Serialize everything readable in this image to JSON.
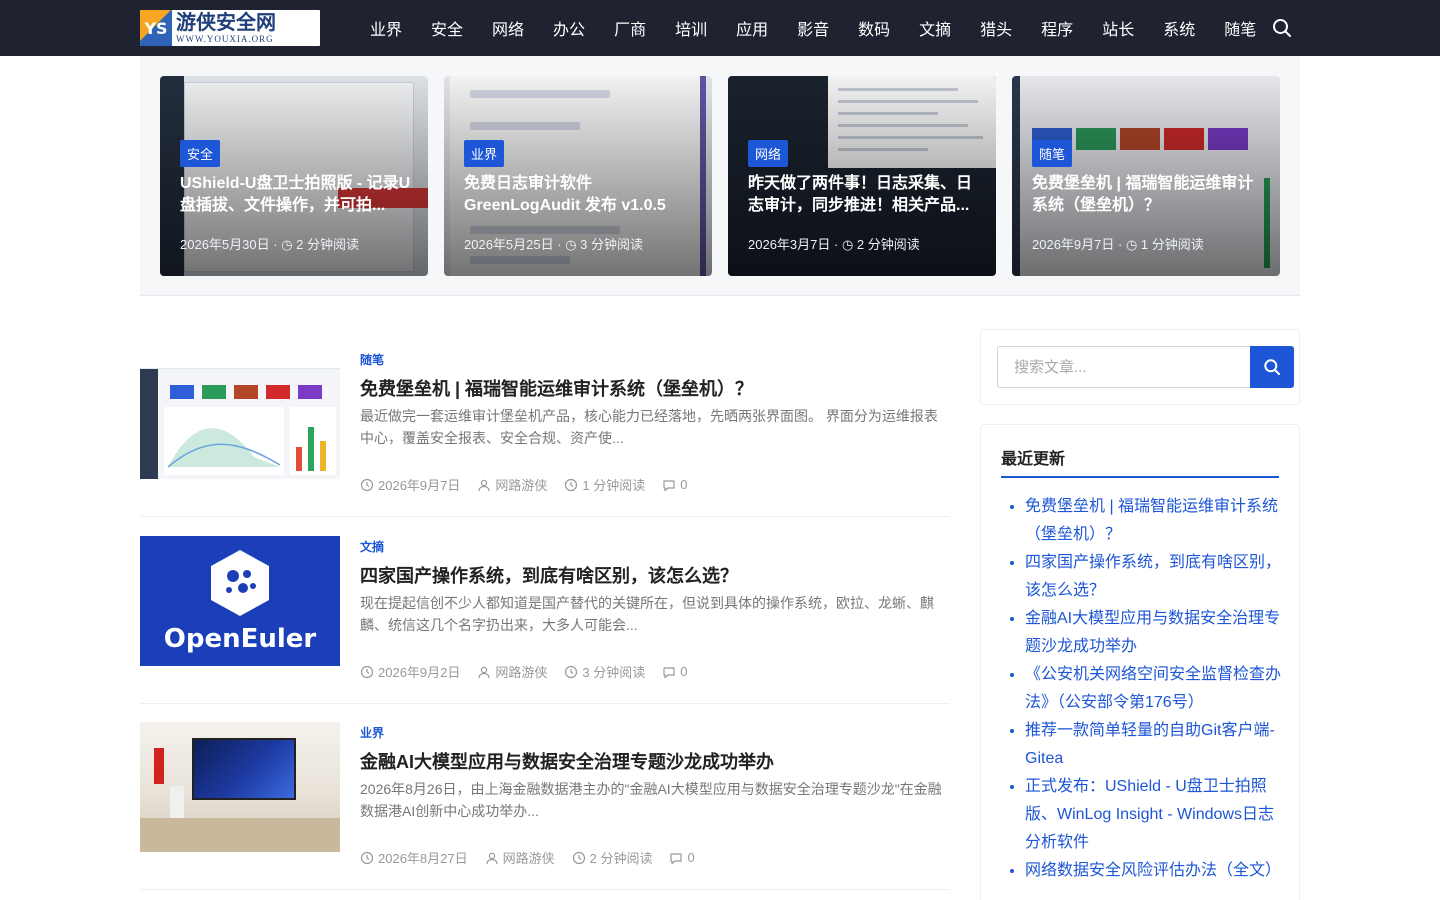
{
  "site": {
    "logo_cn": "游侠安全网",
    "logo_en": "WWW.YOUXIA.ORG",
    "logo_mark": "YS"
  },
  "nav": [
    "业界",
    "安全",
    "网络",
    "办公",
    "厂商",
    "培训",
    "应用",
    "影音",
    "数码",
    "文摘",
    "猎头",
    "程序",
    "站长",
    "系统",
    "随笔"
  ],
  "featured": [
    {
      "tag": "安全",
      "title": "UShield-U盘卫士拍照版 - 记录U盘插拔、文件操作，并可拍...",
      "date": "2026年5月30日",
      "read": "2 分钟阅读"
    },
    {
      "tag": "业界",
      "title": "免费日志审计软件 GreenLogAudit 发布 v1.0.5",
      "date": "2026年5月25日",
      "read": "3 分钟阅读"
    },
    {
      "tag": "网络",
      "title": "昨天做了两件事！日志采集、日志审计，同步推进！相关产品...",
      "date": "2026年3月7日",
      "read": "2 分钟阅读"
    },
    {
      "tag": "随笔",
      "title": "免费堡垒机 | 福瑞智能运维审计系统（堡垒机）？",
      "date": "2026年9月7日",
      "read": "1 分钟阅读"
    }
  ],
  "articles": [
    {
      "category": "随笔",
      "title": "免费堡垒机 | 福瑞智能运维审计系统（堡垒机）？",
      "excerpt": "最近做完一套运维审计堡垒机产品，核心能力已经落地，先晒两张界面图。 界面分为运维报表中心，覆盖安全报表、安全合规、资产使...",
      "date": "2026年9月7日",
      "author": "网路游侠",
      "read": "1 分钟阅读",
      "comments": "0"
    },
    {
      "category": "文摘",
      "title": "四家国产操作系统，到底有啥区别，该怎么选？",
      "excerpt": "现在提起信创不少人都知道是国产替代的关键所在，但说到具体的操作系统，欧拉、龙蜥、麒麟、统信这几个名字扔出来，大多人可能会...",
      "date": "2026年9月2日",
      "author": "网路游侠",
      "read": "3 分钟阅读",
      "comments": "0",
      "thumb_text": "OpenEuler"
    },
    {
      "category": "业界",
      "title": "金融AI大模型应用与数据安全治理专题沙龙成功举办",
      "excerpt": "2026年8月26日，由上海金融数据港主办的\"金融AI大模型应用与数据安全治理专题沙龙\"在金融数据港AI创新中心成功举办...",
      "date": "2026年8月27日",
      "author": "网路游侠",
      "read": "2 分钟阅读",
      "comments": "0"
    }
  ],
  "sidebar": {
    "search_placeholder": "搜索文章...",
    "recent_title": "最近更新",
    "recent": [
      "免费堡垒机 | 福瑞智能运维审计系统（堡垒机）？",
      "四家国产操作系统，到底有啥区别，该怎么选？",
      "金融AI大模型应用与数据安全治理专题沙龙成功举办",
      "《公安机关网络空间安全监督检查办法》（公安部令第176号）",
      "推荐一款简单轻量的自助Git客户端-Gitea",
      "正式发布：UShield - U盘卫士拍照版、WinLog Insight - Windows日志分析软件",
      "网络数据安全风险评估办法（全文）"
    ]
  },
  "colors": {
    "header_bg": "#1f2330",
    "accent": "#1d56d6"
  }
}
